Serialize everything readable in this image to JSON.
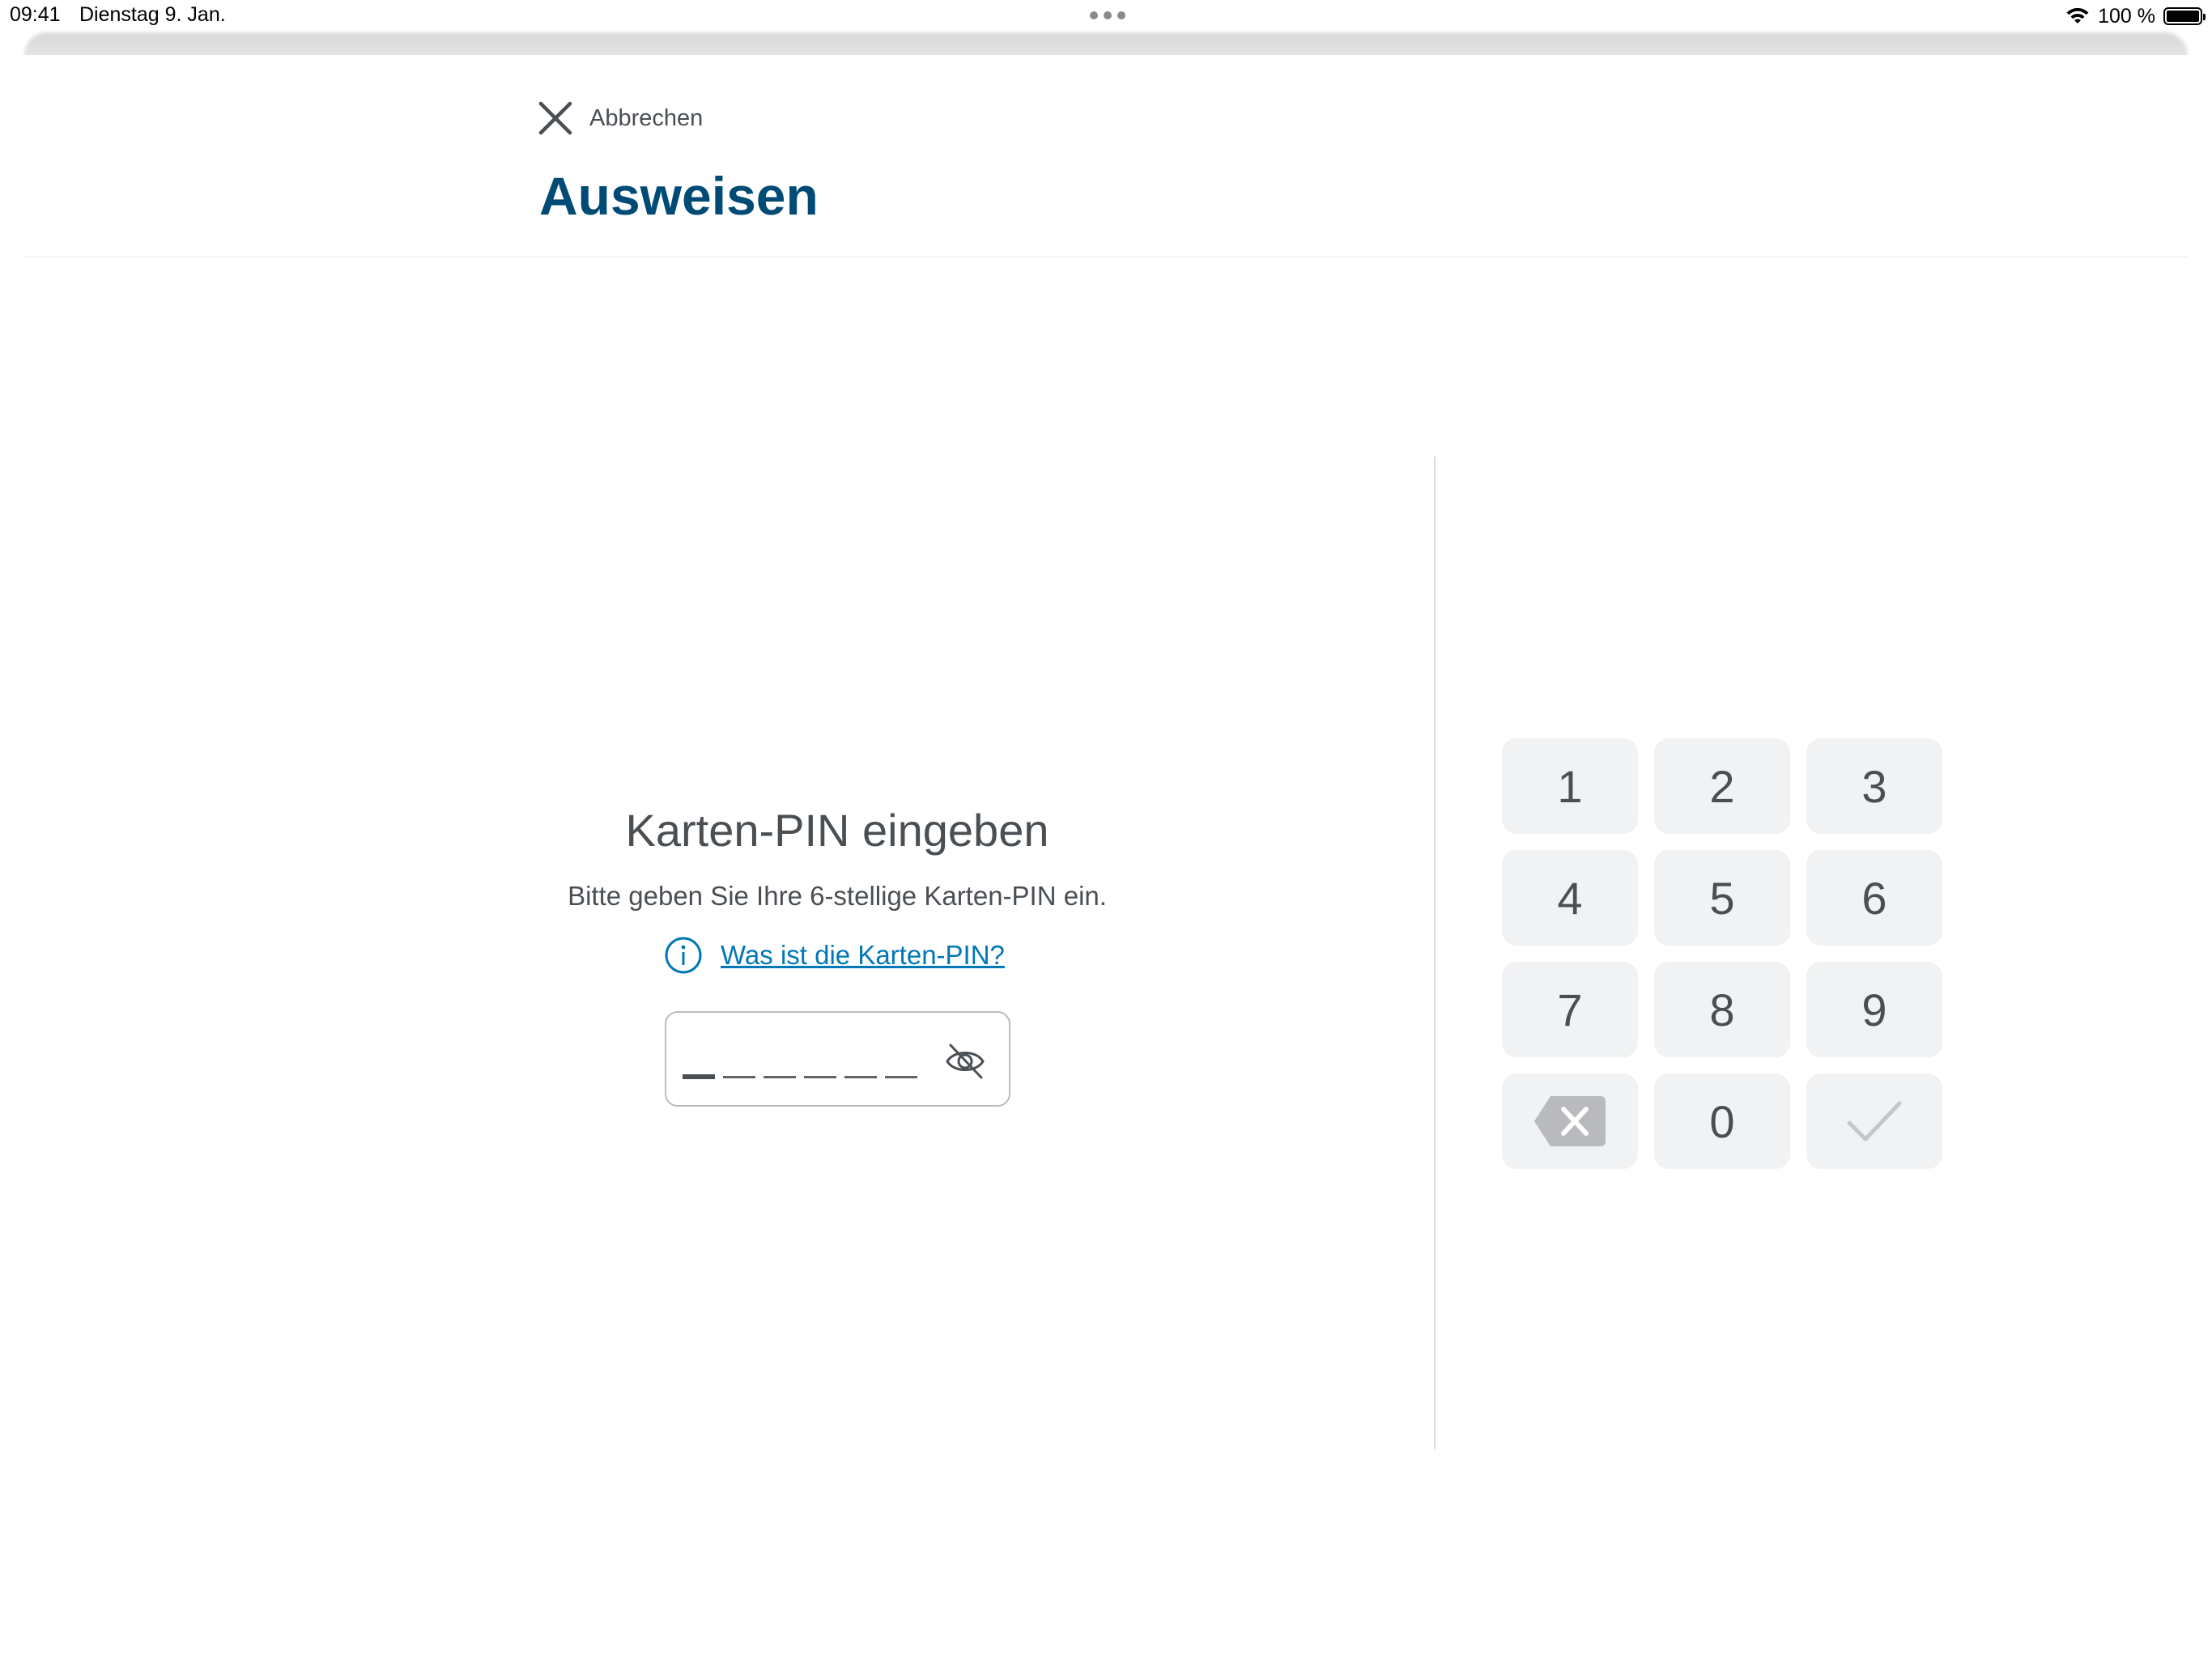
{
  "status_bar": {
    "time": "09:41",
    "date": "Dienstag 9. Jan.",
    "battery_text": "100 %",
    "icons": [
      "wifi-icon",
      "battery-icon"
    ]
  },
  "header": {
    "cancel_label": "Abbrechen",
    "cancel_icon": "close-icon",
    "title": "Ausweisen"
  },
  "pin_entry": {
    "heading": "Karten-PIN eingeben",
    "subtitle": "Bitte geben Sie Ihre 6-stellige Karten-PIN ein.",
    "help_link": "Was ist die Karten-PIN?",
    "help_icon": "info-icon",
    "digits_entered": 0,
    "digits_total": 6,
    "visibility_icon": "eye-off-icon"
  },
  "keypad": {
    "keys": [
      "1",
      "2",
      "3",
      "4",
      "5",
      "6",
      "7",
      "8",
      "9"
    ],
    "zero": "0",
    "delete_icon": "backspace-icon",
    "confirm_icon": "checkmark-icon"
  },
  "colors": {
    "title": "#004b76",
    "link": "#0077b6",
    "text": "#4a4f54",
    "key_background": "#f1f2f4"
  }
}
